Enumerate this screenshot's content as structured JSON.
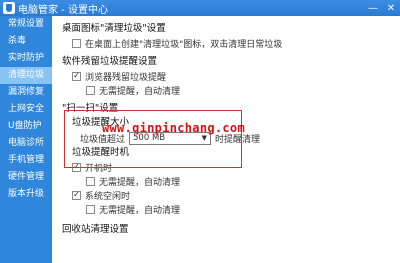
{
  "window": {
    "title": "电脑管家 - 设置中心",
    "min_label": "—",
    "close_label": "✕"
  },
  "sidebar": {
    "items": [
      {
        "label": "常规设置",
        "active": false
      },
      {
        "label": "杀毒",
        "active": false
      },
      {
        "label": "实时防护",
        "active": false
      },
      {
        "label": "清理垃圾",
        "active": true
      },
      {
        "label": "漏洞修复",
        "active": false
      },
      {
        "label": "上网安全",
        "active": false
      },
      {
        "label": "U盘防护",
        "active": false
      },
      {
        "label": "电脑诊所",
        "active": false
      },
      {
        "label": "手机管理",
        "active": false
      },
      {
        "label": "硬件管理",
        "active": false
      },
      {
        "label": "版本升级",
        "active": false
      }
    ]
  },
  "content": {
    "desktop_icon": {
      "title": "桌面图标\"清理垃圾\"设置",
      "option": "在桌面上创建\"清理垃圾\"图标，双击清理日常垃圾",
      "checked": false
    },
    "residue": {
      "title": "软件残留垃圾提醒设置",
      "opt1": "浏览器残留垃圾提醒",
      "opt1_checked": true,
      "opt2": "无需提醒，自动清理",
      "opt2_checked": false
    },
    "scan": {
      "title": "\"扫一扫\"设置",
      "size_title": "垃圾提醒大小",
      "prefix": "垃圾值超过",
      "select_value": "500 MB",
      "suffix": "时提醒清理",
      "timing_title": "垃圾提醒时机",
      "opt_startup": "开机时",
      "opt_startup_checked": true,
      "opt_startup_auto": "无需提醒，自动清理",
      "opt_startup_auto_checked": false,
      "opt_idle": "系统空闲时",
      "opt_idle_checked": true,
      "opt_idle_auto": "无需提醒，自动清理",
      "opt_idle_auto_checked": false
    },
    "recycle": {
      "title": "回收站清理设置"
    }
  },
  "watermark": "www.qinpinchang.com"
}
